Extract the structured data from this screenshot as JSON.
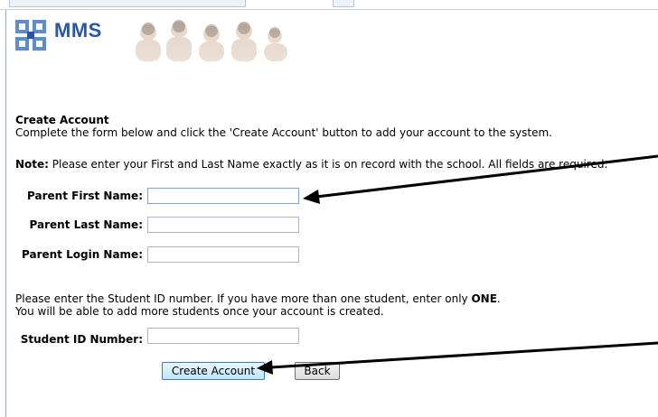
{
  "header": {
    "brand": "MMS"
  },
  "page": {
    "title": "Create Account",
    "intro": "Complete the form below and click the 'Create Account' button to add your account to the system.",
    "note_label": "Note:",
    "note_text": " Please enter your First and Last Name exactly as it is on record with the school. All fields are required."
  },
  "form": {
    "first_name": {
      "label": "Parent First Name:",
      "value": ""
    },
    "last_name": {
      "label": "Parent Last Name:",
      "value": ""
    },
    "login_name": {
      "label": "Parent Login Name:",
      "value": ""
    },
    "student_id": {
      "label": "Student ID Number:",
      "value": ""
    }
  },
  "student_instructions": {
    "line1_pre": "Please enter the Student ID number. If you have more than one student, enter only ",
    "line1_bold": "ONE",
    "line1_post": ".",
    "line2": "You will be able to add more students once your account is created."
  },
  "buttons": {
    "create": "Create Account",
    "back": "Back"
  },
  "colors": {
    "brand": "#2a55a8",
    "arrow": "#000000"
  }
}
